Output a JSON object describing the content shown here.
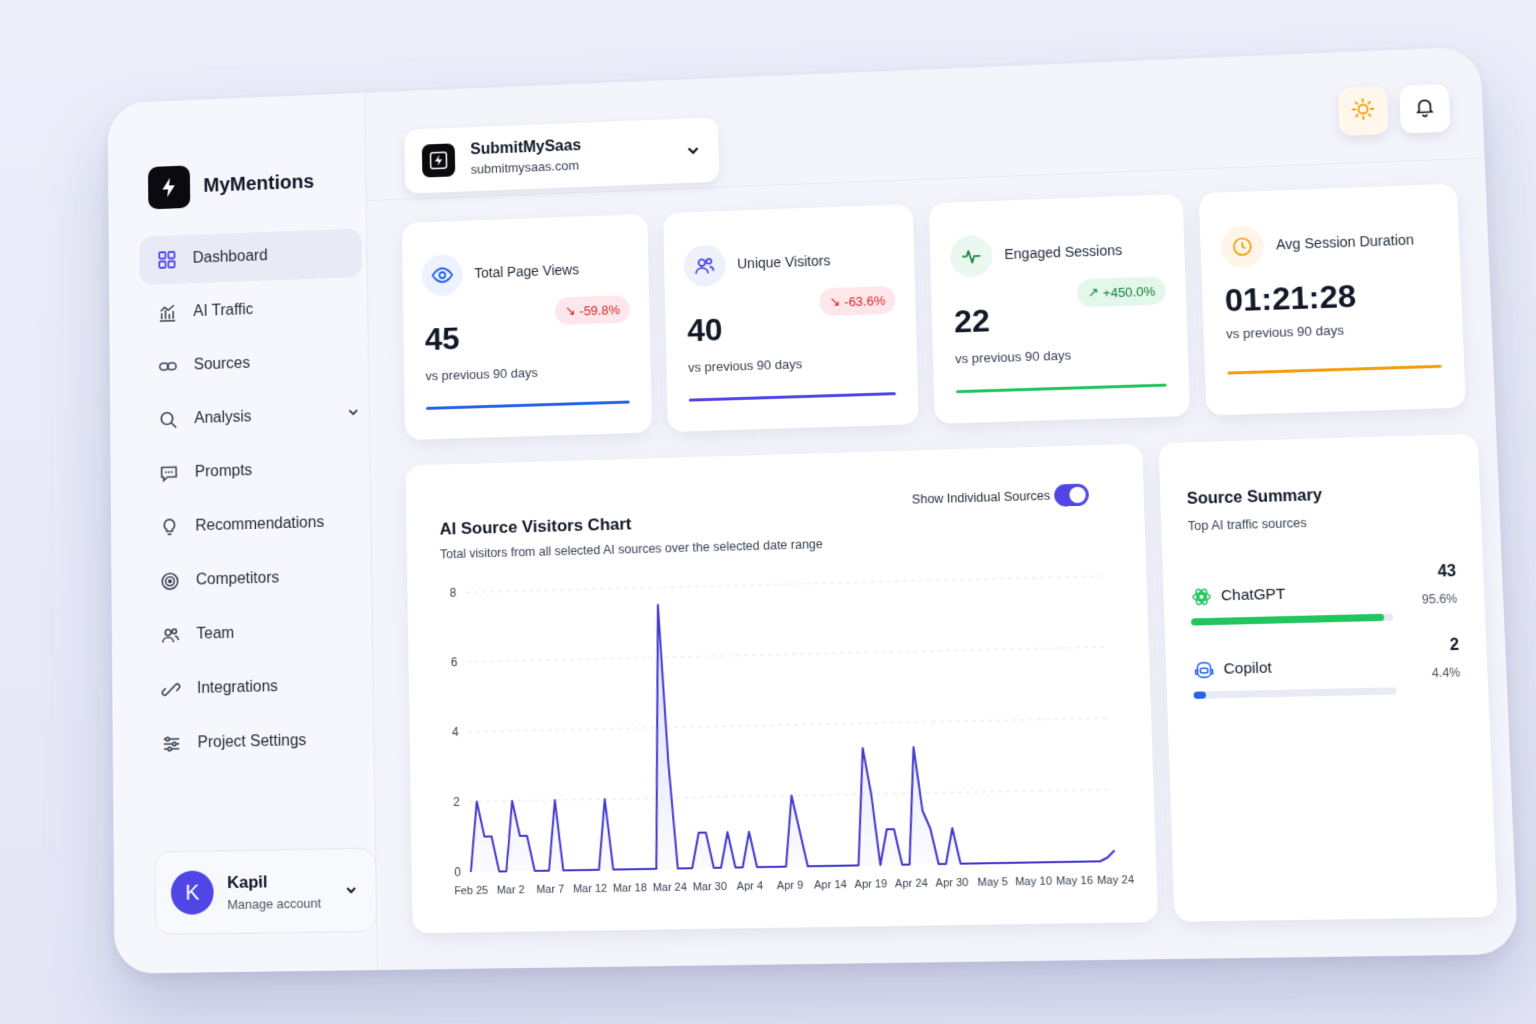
{
  "brand": {
    "name": "MyMentions"
  },
  "nav": {
    "items": [
      {
        "label": "Dashboard",
        "icon": "grid-icon",
        "active": true
      },
      {
        "label": "AI Traffic",
        "icon": "bar-chart-icon"
      },
      {
        "label": "Sources",
        "icon": "link-icon"
      },
      {
        "label": "Analysis",
        "icon": "search-icon",
        "expandable": true
      },
      {
        "label": "Prompts",
        "icon": "message-icon"
      },
      {
        "label": "Recommendations",
        "icon": "lightbulb-icon"
      },
      {
        "label": "Competitors",
        "icon": "target-icon"
      },
      {
        "label": "Team",
        "icon": "users-icon"
      },
      {
        "label": "Integrations",
        "icon": "plug-icon"
      },
      {
        "label": "Project Settings",
        "icon": "sliders-icon"
      }
    ]
  },
  "account": {
    "initial": "K",
    "name": "Kapil",
    "subtitle": "Manage account"
  },
  "project": {
    "name": "SubmitMySaas",
    "url": "submitmysaas.com"
  },
  "topbar": {
    "theme_icon": "sun-icon",
    "notifications_icon": "bell-icon"
  },
  "stats": [
    {
      "label": "Total Page Views",
      "value": "45",
      "change": "-59.8%",
      "trend": "down",
      "subtitle": "vs previous 90 days",
      "color": "#2563eb"
    },
    {
      "label": "Unique Visitors",
      "value": "40",
      "change": "-63.6%",
      "trend": "down",
      "subtitle": "vs previous 90 days",
      "color": "#4f46e5"
    },
    {
      "label": "Engaged Sessions",
      "value": "22",
      "change": "+450.0%",
      "trend": "up",
      "subtitle": "vs previous 90 days",
      "color": "#22c55e"
    },
    {
      "label": "Avg Session Duration",
      "value": "01:21:28",
      "change": "",
      "trend": "",
      "subtitle": "vs previous 90 days",
      "color": "#f59e0b"
    }
  ],
  "chart": {
    "title": "AI Source Visitors Chart",
    "subtitle": "Total visitors from all selected AI sources over the selected date range",
    "toggle_label": "Show Individual Sources",
    "toggle_on": true
  },
  "chart_data": {
    "type": "area",
    "title": "AI Source Visitors Chart",
    "color": "#4338ca",
    "ylim": [
      0,
      8
    ],
    "yticks": [
      0,
      2,
      4,
      6,
      8
    ],
    "xticks": [
      "Feb 25",
      "Mar 2",
      "Mar 7",
      "Mar 12",
      "Mar 18",
      "Mar 24",
      "Mar 30",
      "Apr 4",
      "Apr 9",
      "Apr 14",
      "Apr 19",
      "Apr 24",
      "Apr 30",
      "May 5",
      "May 10",
      "May 16",
      "May 24"
    ],
    "x": [
      0,
      1,
      2,
      3,
      4,
      5,
      6,
      7,
      8,
      9,
      10,
      11,
      12,
      13,
      14,
      15,
      16,
      17,
      18,
      19,
      20,
      21,
      22,
      23,
      24,
      25,
      26,
      27,
      28,
      29,
      30,
      31,
      32,
      33,
      34,
      35,
      36,
      37,
      38,
      39,
      40,
      41,
      42,
      43,
      44,
      45,
      46,
      47,
      48,
      49,
      50,
      51,
      52,
      53,
      54,
      55,
      56,
      57,
      58,
      59,
      60,
      61,
      62,
      63,
      64,
      65,
      66,
      67,
      68,
      69,
      70,
      71,
      72,
      73,
      74,
      75,
      76,
      77,
      78,
      79,
      80,
      81,
      82,
      83,
      84,
      85,
      86,
      87,
      88,
      89
    ],
    "y": [
      0,
      2,
      1,
      1,
      0,
      0,
      2,
      1,
      1,
      0,
      0,
      0,
      2,
      0,
      0,
      0,
      0,
      0,
      0,
      2,
      0,
      0,
      0,
      0,
      0,
      0,
      0,
      7.5,
      3,
      0,
      0,
      0,
      1,
      1,
      0,
      0,
      1,
      0,
      0,
      1,
      0,
      0,
      0,
      0,
      0,
      2,
      1,
      0,
      0,
      0,
      0,
      0,
      0,
      0,
      0,
      3.3,
      2,
      0,
      1,
      1,
      0,
      0,
      3.3,
      1.5,
      1,
      0,
      0,
      1,
      0,
      0,
      0,
      0,
      0,
      0,
      0,
      0,
      0,
      0,
      0,
      0,
      0,
      0,
      0,
      0,
      0,
      0,
      0,
      0,
      0.1,
      0.3
    ]
  },
  "summary": {
    "title": "Source Summary",
    "subtitle": "Top AI traffic sources",
    "sources": [
      {
        "name": "ChatGPT",
        "count": "43",
        "percent": "95.6%",
        "share": 0.956,
        "color": "#22c55e",
        "icon": "chatgpt-icon"
      },
      {
        "name": "Copilot",
        "count": "2",
        "percent": "4.4%",
        "share": 0.044,
        "color": "#2563eb",
        "icon": "copilot-icon"
      }
    ]
  }
}
